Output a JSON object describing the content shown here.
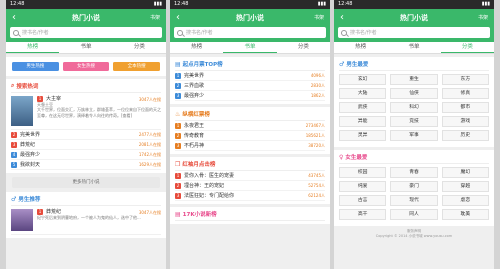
{
  "status": {
    "time": "12:48"
  },
  "header": {
    "title": "热门小说",
    "shelf": "书架"
  },
  "search": {
    "placeholder": "搜书名/作者"
  },
  "tabs": [
    "热榜",
    "书单",
    "分类"
  ],
  "screen1": {
    "tags": [
      {
        "label": "男生热搜",
        "color": "#4a90e2"
      },
      {
        "label": "女生热搜",
        "color": "#f06a9a"
      },
      {
        "label": "全本热搜",
        "color": "#f0a030"
      }
    ],
    "section1": {
      "title": "搜索热词",
      "featured": {
        "rank": "1",
        "name": "大主宰",
        "count": "3047人在搜",
        "author": "天蚕土豆",
        "desc": "大千世界，位面交汇，万族林立，群雄荟萃，一位位来自下位面的天之至尊，在这无尽世界，演绎着令人向往的传奇。[查看]"
      },
      "rows": [
        {
          "rank": "2",
          "name": "完美世界",
          "count": "2477人在搜"
        },
        {
          "rank": "3",
          "name": "莽荒纪",
          "count": "2081人在搜"
        },
        {
          "rank": "4",
          "name": "最强弃少",
          "count": "1742人在搜"
        },
        {
          "rank": "5",
          "name": "我欲封天",
          "count": "1629人在搜"
        }
      ],
      "more": "更多热门小说"
    },
    "section2": {
      "title": "男生推荐",
      "featured": {
        "rank": "1",
        "name": "莽荒纪",
        "count": "3047人在搜",
        "desc": "纪宁死后来到阴曹地府，一个被人为鬼的仙人，选中了他..."
      }
    }
  },
  "screen2": {
    "s1": {
      "title": "起点月票TOP榜",
      "rows": [
        {
          "rank": "1",
          "name": "完美世界",
          "count": "4096人"
        },
        {
          "rank": "2",
          "name": "三界血歌",
          "count": "2830人"
        },
        {
          "rank": "3",
          "name": "最强弃少",
          "count": "1862人"
        }
      ]
    },
    "s2": {
      "title": "纵横红票榜",
      "rows": [
        {
          "rank": "1",
          "name": "永夜君王",
          "count": "273467人"
        },
        {
          "rank": "2",
          "name": "传奇教育",
          "count": "185621人"
        },
        {
          "rank": "3",
          "name": "不朽丹神",
          "count": "38720人"
        }
      ]
    },
    "s3": {
      "title": "红袖月点击榜",
      "rows": [
        {
          "rank": "1",
          "name": "爱你入骨：医生的宠妻",
          "count": "43745人"
        },
        {
          "rank": "2",
          "name": "埋台神：王的宠妃",
          "count": "52754人"
        },
        {
          "rank": "3",
          "name": "法医狂妃：专门配给你",
          "count": "62124人"
        }
      ]
    },
    "s4": {
      "title": "17K小说新榜"
    }
  },
  "screen3": {
    "male": {
      "title": "男生最爱",
      "items": [
        "玄幻",
        "重生",
        "东方",
        "大陆",
        "仙侠",
        "修真",
        "武侠",
        "科幻",
        "都市",
        "异能",
        "竞技",
        "游戏",
        "灵异",
        "军事",
        "历史"
      ]
    },
    "female": {
      "title": "女生最爱",
      "items": [
        "校园",
        "青春",
        "魔幻",
        "纯爱",
        "豪门",
        "穿越",
        "古言",
        "现代",
        "虐恋",
        "高干",
        "同人",
        "耽美"
      ]
    },
    "footer": {
      "line1": "服务声明",
      "line2": "Copyright © 2014 小说书城 www.yousu.com"
    }
  }
}
